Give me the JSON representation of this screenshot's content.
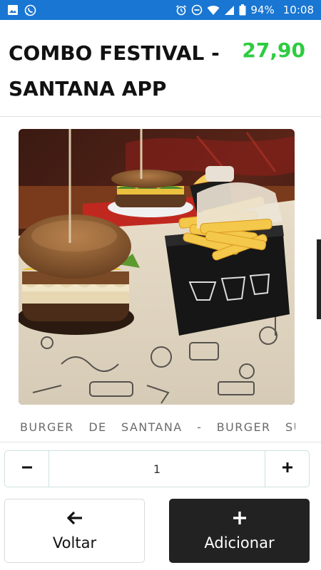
{
  "status_bar": {
    "battery": "94%",
    "time": "10:08",
    "left_icons": [
      "gallery-icon",
      "whatsapp-icon"
    ],
    "right_icons": [
      "alarm-icon",
      "do-not-disturb-icon",
      "wifi-icon",
      "cell-signal-icon",
      "battery-icon"
    ]
  },
  "product": {
    "title": "COMBO FESTIVAL - SANTANA APP",
    "price": "27,90",
    "description": "BURGER DE SANTANA - BURGER SUINO,",
    "image": "burger-and-fries-photo"
  },
  "quantity": {
    "value": "1",
    "decrement_icon": "minus-icon",
    "increment_icon": "plus-icon"
  },
  "actions": {
    "back_label": "Voltar",
    "back_icon": "arrow-left-icon",
    "add_label": "Adicionar",
    "add_icon": "plus-icon"
  },
  "colors": {
    "status_bar": "#1976d2",
    "price": "#2ecc40",
    "add_button": "#222222"
  }
}
